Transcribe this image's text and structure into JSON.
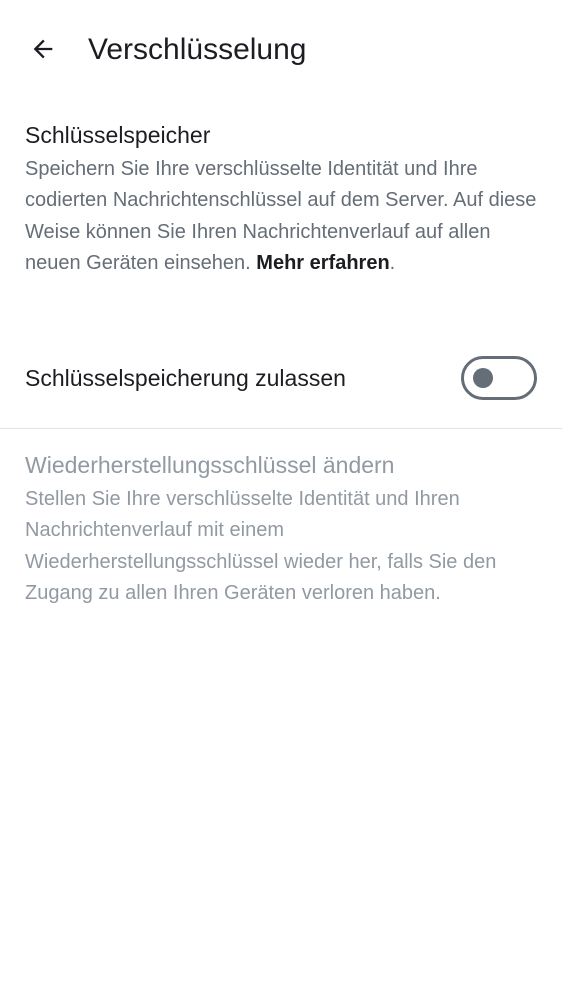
{
  "header": {
    "title": "Verschlüsselung",
    "back_icon": "arrow-left-icon"
  },
  "key_storage": {
    "title": "Schlüsselspeicher",
    "description": "Speichern Sie Ihre verschlüsselte Identität und Ihre codierten Nachrichtenschlüssel auf dem Server. Auf diese Weise können Sie Ihren Nachrichtenverlauf auf allen neuen Geräten einsehen.",
    "learn_more": "Mehr erfahren",
    "trailing_punct": "."
  },
  "toggle": {
    "label": "Schlüsselspeicherung zulassen",
    "enabled": false
  },
  "recovery": {
    "title": "Wiederherstellungsschlüssel ändern",
    "description": "Stellen Sie Ihre verschlüsselte Identität und Ihren Nachrichtenverlauf mit einem Wiederherstellungsschlüssel wieder her, falls Sie den Zugang zu allen Ihren Geräten verloren haben.",
    "disabled": true
  },
  "colors": {
    "primary_text": "#1b1d22",
    "secondary_text": "#656d77",
    "disabled_text": "#9199a2",
    "divider": "#e1e3e6",
    "background": "#ffffff"
  }
}
